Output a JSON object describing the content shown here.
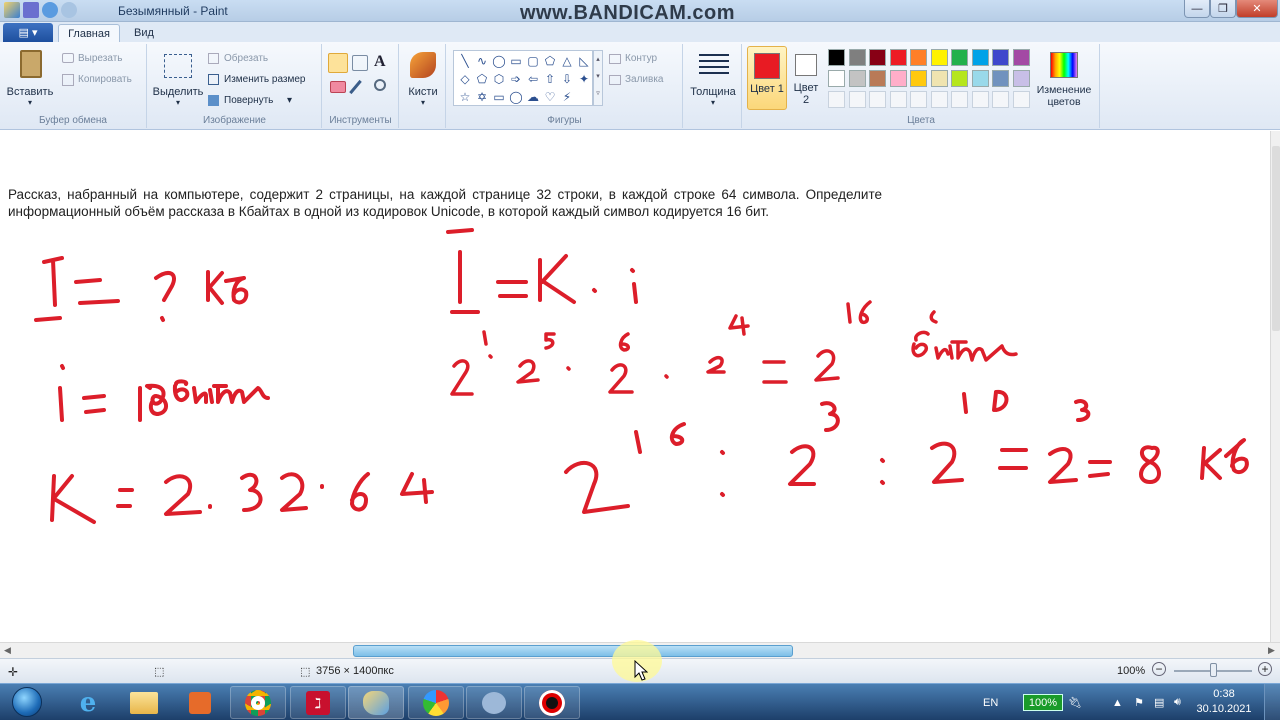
{
  "window": {
    "title": "Безымянный - Paint",
    "watermark": "www.BANDICAM.com",
    "close_glyph": "✕",
    "max_glyph": "❐",
    "min_glyph": "—"
  },
  "ribbon_tabs": [
    {
      "label": "Главная",
      "active": true
    },
    {
      "label": "Вид",
      "active": false
    }
  ],
  "app_menu_glyph": "▤ ▾",
  "ribbon": {
    "clipboard": {
      "group_label": "Буфер обмена",
      "paste": "Вставить",
      "cut": "Вырезать",
      "copy": "Копировать"
    },
    "image": {
      "group_label": "Изображение",
      "select": "Выделить",
      "crop": "Обрезать",
      "resize": "Изменить размер",
      "rotate": "Повернуть"
    },
    "tools": {
      "group_label": "Инструменты"
    },
    "brushes": {
      "label": "Кисти"
    },
    "shapes": {
      "group_label": "Фигуры",
      "outline": "Контур",
      "fill": "Заливка",
      "items": [
        "╲",
        "∿",
        "◯",
        "▭",
        "▢",
        "⬠",
        "△",
        "◺",
        "◇",
        "⬠",
        "⬡",
        "➩",
        "⇦",
        "⇧",
        "⇩",
        "✦",
        "☆",
        "✡",
        "▭",
        "◯",
        "☁",
        "♡",
        "⚡"
      ]
    },
    "size": {
      "label": "Толщина"
    },
    "color1": {
      "label": "Цвет 1",
      "value": "#e81b23"
    },
    "color2": {
      "label": "Цвет 2",
      "value": "#ffffff"
    },
    "colors": {
      "group_label": "Цвета",
      "row1": [
        "#000000",
        "#7f7f7f",
        "#880015",
        "#ed1c24",
        "#ff7f27",
        "#fff200",
        "#22b14c",
        "#00a2e8",
        "#3f48cc",
        "#a349a4"
      ],
      "row2": [
        "#ffffff",
        "#c3c3c3",
        "#b97a57",
        "#ffaec9",
        "#ffc90e",
        "#efe4b0",
        "#b5e61d",
        "#99d9ea",
        "#7092be",
        "#c8bfe7"
      ]
    },
    "edit_colors": "Изменение цветов"
  },
  "canvas": {
    "problem_text": "Рассказ, набранный на компьютере, содержит 2 страницы, на каждой странице 32 строки, в каждой строке 64 символа. Определите информационный объём рассказа в Кбайтах в одной из кодировок Unicode, в которой каждый символ кодируется 16 бит.",
    "handwriting": {
      "line1_left": "I = ? Кб",
      "line2_left": "i = 16 бит",
      "line3_left": "K = 2 · 32 · 64",
      "formula": "I = K · i",
      "powers": "2¹ · 2⁵ · 2⁶ · 2⁴ = 2¹⁶ бит",
      "result": "2¹⁶ : 2³ : 2¹⁰ = 2³ = 8 Кб"
    }
  },
  "status": {
    "dimensions": "3756 × 1400пкс",
    "zoom": "100%"
  },
  "taskbar": {
    "language": "EN",
    "battery": "100%",
    "time": "0:38",
    "date": "30.10.2021"
  },
  "colors": {
    "ink": "#dc1e2a",
    "accent": "#1e4f9e"
  }
}
